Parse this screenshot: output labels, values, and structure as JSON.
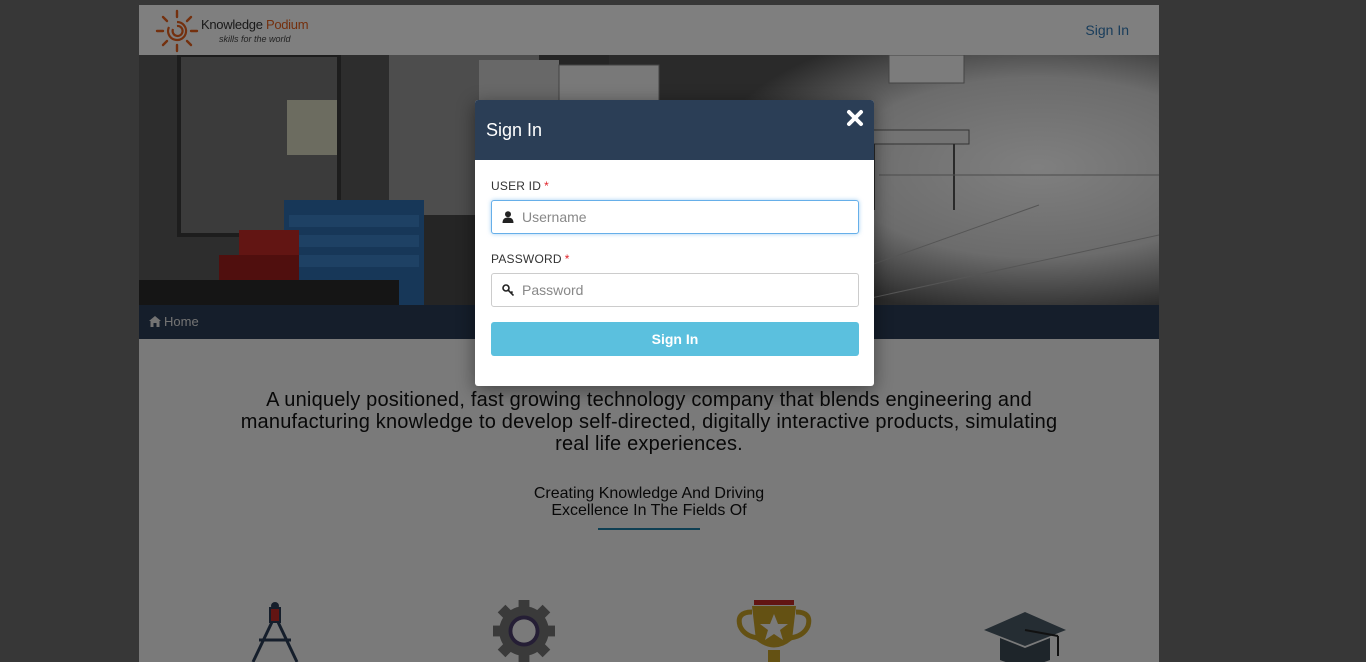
{
  "brand": {
    "name_part1": "Knowledge",
    "name_part2": "Podium",
    "tagline": "skills for the world",
    "accent_color": "#e8601c"
  },
  "nav": {
    "signin_label": "Sign In"
  },
  "breadcrumb": {
    "home_icon": "home-icon",
    "home_label": "Home"
  },
  "main": {
    "intro_text": "A uniquely positioned, fast growing technology company that blends engineering and manufacturing knowledge to develop self-directed, digitally interactive products, simulating real life experiences.",
    "tagline_line1": "Creating Knowledge And Driving",
    "tagline_line2": "Excellence In The Fields Of",
    "features": [
      {
        "icon": "compass-icon"
      },
      {
        "icon": "gear-icon"
      },
      {
        "icon": "trophy-icon"
      },
      {
        "icon": "graduation-cap-icon"
      }
    ]
  },
  "modal": {
    "title": "Sign In",
    "close_icon": "close-icon",
    "user_id_label": "USER ID",
    "user_id_placeholder": "Username",
    "user_id_icon": "user-icon",
    "password_label": "PASSWORD",
    "password_placeholder": "Password",
    "password_icon": "key-icon",
    "required_mark": "*",
    "submit_label": "Sign In",
    "header_color": "#2b3e56",
    "button_color": "#5bc0de"
  }
}
